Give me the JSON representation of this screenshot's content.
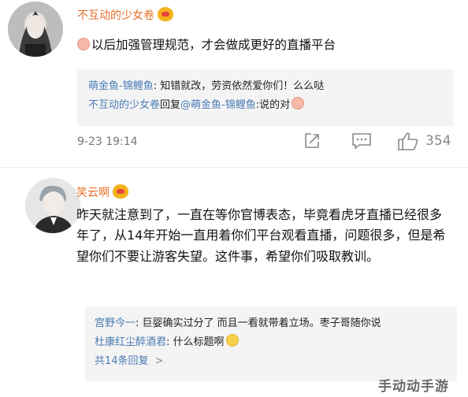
{
  "posts": [
    {
      "username": "不互动的少女卷",
      "text": "以后加强管理规范，才会做成更好的直播平台",
      "replies": [
        {
          "author": "萌金鱼-锦鲤鱼",
          "sep": ": ",
          "content": "知错就改，劳资依然爱你们！么么哒"
        },
        {
          "author": "不互动的少女卷",
          "mid": "回复",
          "mention": "@萌金鱼-锦鲤鱼",
          "sep": ":",
          "content": "说的对"
        }
      ],
      "timestamp": "9-23 19:14",
      "like_count": "354"
    },
    {
      "username": "笑云啊",
      "text": "昨天就注意到了，一直在等你官博表态，毕竟看虎牙直播已经很多年了，从14年开始一直用着你们平台观看直播，问题很多，但是希望你们不要让游客失望。这件事，希望你们吸取教训。",
      "replies": [
        {
          "author": "宫野今一",
          "sep": ": ",
          "content": "巨婴确实过分了 而且一看就带着立场。枣子哥随你说"
        },
        {
          "author": "杜康红尘醉酒君",
          "sep": ": ",
          "content": "什么标题啊"
        }
      ],
      "more_replies": "共14条回复",
      "more_chevron": ">"
    }
  ],
  "watermark": "手动动手游",
  "colors": {
    "username": "#e5702a",
    "link": "#4a7cb5",
    "reply_bg": "#f4f4f4",
    "meta": "#777777"
  },
  "icons": [
    "vip-crown-badge",
    "emoji-face",
    "share-icon",
    "comment-icon",
    "like-icon"
  ]
}
